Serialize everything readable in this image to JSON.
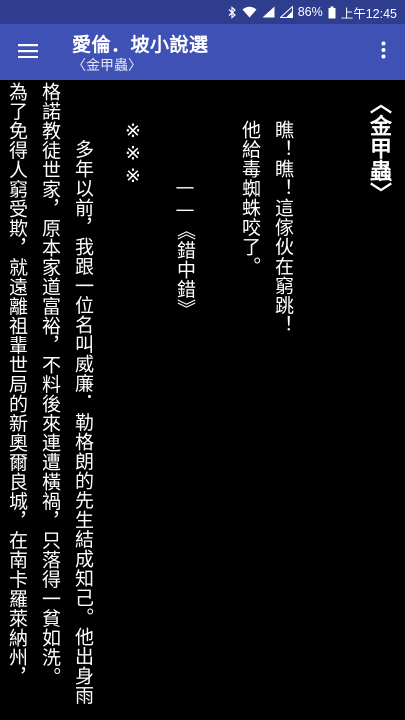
{
  "status_bar": {
    "battery_percent": "86%",
    "time": "上午12:45"
  },
  "app_bar": {
    "title": "愛倫．坡小說選",
    "subtitle": "〈金甲蟲〉"
  },
  "reader": {
    "lines": [
      "〈金甲蟲〉",
      "瞧！瞧！這傢伙在窮跳！",
      "他給毒蜘蛛咬了。",
      "——《錯中錯》",
      "※※※",
      "　多年以前，我跟一位名叫威廉．勒格朗的先生結成知己。他出身雨",
      "格諾教徒世家，原本家道富裕，不料後來連遭橫禍，只落得一貧如洗。",
      "為了免得人窮受欺，就遠離祖輩世局的新奧爾良城，在南卡羅萊納州，"
    ]
  }
}
